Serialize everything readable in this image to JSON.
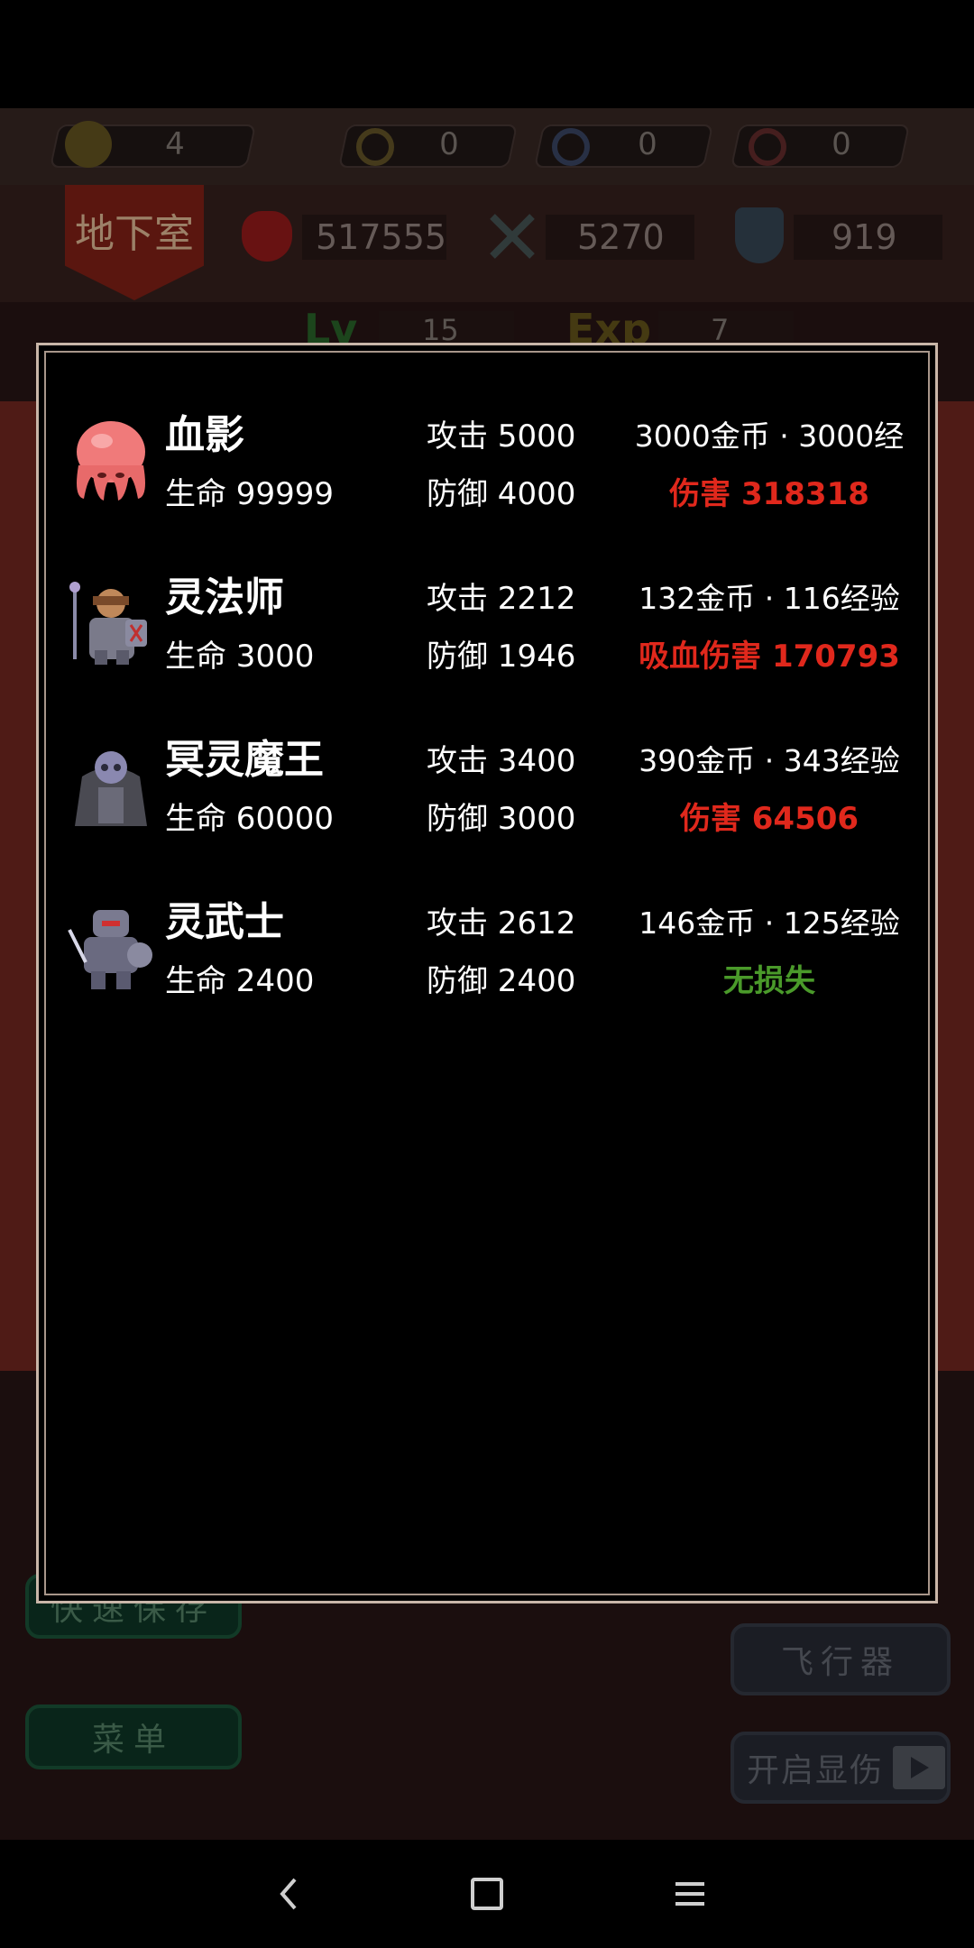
{
  "resources": {
    "coins": "4",
    "yellow_keys": "0",
    "blue_keys": "0",
    "red_keys": "0"
  },
  "hero": {
    "floor": "地下室",
    "hp": "517555",
    "attack": "5270",
    "defense": "919",
    "lv_label": "Lv",
    "lv": "15",
    "exp_label": "Exp",
    "exp": "7"
  },
  "side_buttons": {
    "quick_save": "快速保存",
    "menu": "菜单",
    "flyer": "飞行器",
    "show_damage": "开启显伤"
  },
  "monsters": [
    {
      "name": "血影",
      "hp": "生命 99999",
      "atk": "攻击 5000",
      "def": "防御 4000",
      "reward": "3000金币 · 3000经",
      "damage": "伤害 318318",
      "damage_type": "red"
    },
    {
      "name": "灵法师",
      "hp": "生命 3000",
      "atk": "攻击 2212",
      "def": "防御 1946",
      "reward": "132金币 · 116经验",
      "damage": "吸血伤害 170793",
      "damage_type": "red"
    },
    {
      "name": "冥灵魔王",
      "hp": "生命 60000",
      "atk": "攻击 3400",
      "def": "防御 3000",
      "reward": "390金币 · 343经验",
      "damage": "伤害 64506",
      "damage_type": "red"
    },
    {
      "name": "灵武士",
      "hp": "生命 2400",
      "atk": "攻击 2612",
      "def": "防御 2400",
      "reward": "146金币 · 125经验",
      "damage": "无损失",
      "damage_type": "green"
    }
  ],
  "colors": {
    "damage_red": "#e0281c",
    "damage_green": "#4a9a2a",
    "modal_border": "#c9b6a8"
  }
}
